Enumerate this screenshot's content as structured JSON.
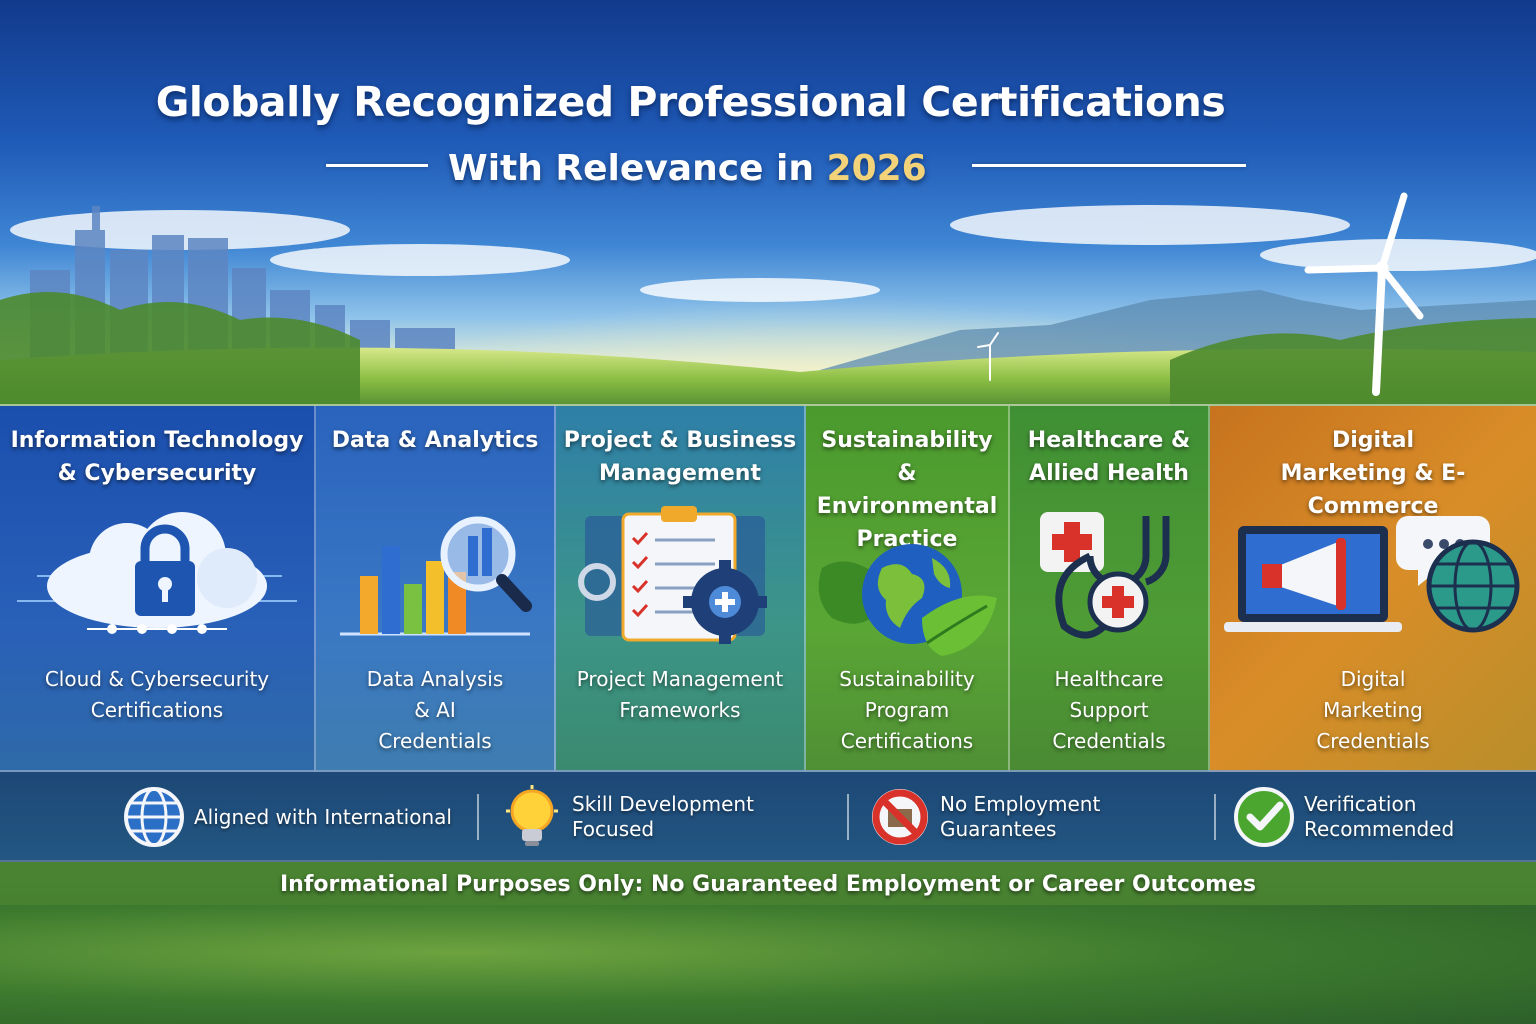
{
  "header": {
    "title": "Globally Recognized Professional Certifications",
    "subtitle_prefix": "With Relevance in",
    "subtitle_year": "2026"
  },
  "panels": [
    {
      "title": "Information Technology & Cybersecurity",
      "desc": "Cloud & Cybersecurity Certifications",
      "icon": "cloud-lock-icon",
      "color": "#1f56b4"
    },
    {
      "title": "Data & Analytics",
      "desc": "Data Analysis & AI Credentials",
      "icon": "bar-chart-magnifier-icon",
      "color": "#2b6cc0"
    },
    {
      "title": "Project & Business Management",
      "desc": "Project Management Frameworks",
      "icon": "clipboard-gear-icon",
      "color": "#2e8a8a"
    },
    {
      "title": "Sustainability & Environmental Practice",
      "desc": "Sustainability Program Certifications",
      "icon": "globe-leaves-icon",
      "color": "#4f9a2c"
    },
    {
      "title": "Healthcare & Allied Health",
      "desc": "Healthcare Support Credentials",
      "icon": "medical-stethoscope-icon",
      "color": "#4b942f"
    },
    {
      "title": "Digital Marketing & E-Commerce",
      "desc": "Digital Marketing Credentials",
      "icon": "laptop-megaphone-icon",
      "color": "#c98320"
    }
  ],
  "features": [
    {
      "label": "Aligned with International",
      "icon": "globe-icon"
    },
    {
      "label": "Skill Development Focused",
      "icon": "lightbulb-icon"
    },
    {
      "label": "No Employment Guarantees",
      "icon": "no-sign-icon"
    },
    {
      "label": "Verification Recommended",
      "icon": "checkmark-icon"
    }
  ],
  "disclaimer": "Informational Purposes Only: No Guaranteed Employment or Career Outcomes"
}
